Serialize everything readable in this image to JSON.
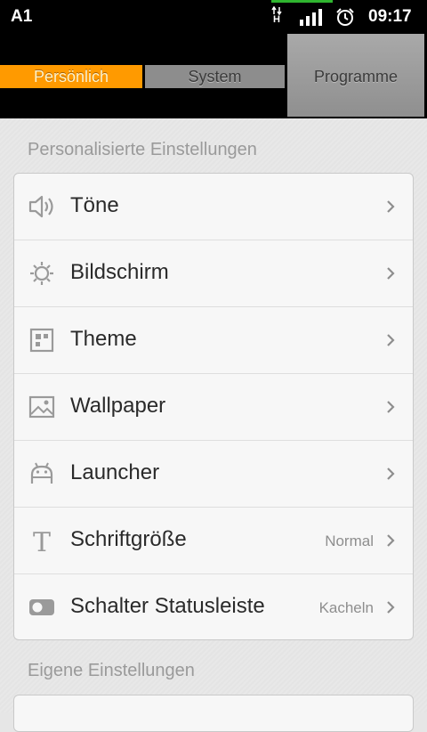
{
  "status_bar": {
    "carrier": "A1",
    "network_type": "H",
    "time": "09:17",
    "icons": [
      "data-arrows-icon",
      "signal-icon",
      "alarm-icon"
    ]
  },
  "tabs": [
    {
      "label": "Persönlich",
      "state": "selected"
    },
    {
      "label": "System",
      "state": "normal"
    },
    {
      "label": "Programme",
      "state": "raised"
    }
  ],
  "colors": {
    "accent": "#ff9a00",
    "tab_inactive": "#8d8d8d",
    "background": "#e6e6e6",
    "card": "#f7f7f7"
  },
  "sections": [
    {
      "title": "Personalisierte Einstellungen",
      "items": [
        {
          "label": "Töne",
          "icon": "speaker-icon",
          "value": ""
        },
        {
          "label": "Bildschirm",
          "icon": "brightness-icon",
          "value": ""
        },
        {
          "label": "Theme",
          "icon": "theme-icon",
          "value": ""
        },
        {
          "label": "Wallpaper",
          "icon": "image-icon",
          "value": ""
        },
        {
          "label": "Launcher",
          "icon": "android-icon",
          "value": ""
        },
        {
          "label": "Schriftgröße",
          "icon": "font-icon",
          "value": "Normal"
        },
        {
          "label": "Schalter Statusleiste",
          "icon": "toggle-icon",
          "value": "Kacheln"
        }
      ]
    },
    {
      "title": "Eigene Einstellungen",
      "items": []
    }
  ]
}
